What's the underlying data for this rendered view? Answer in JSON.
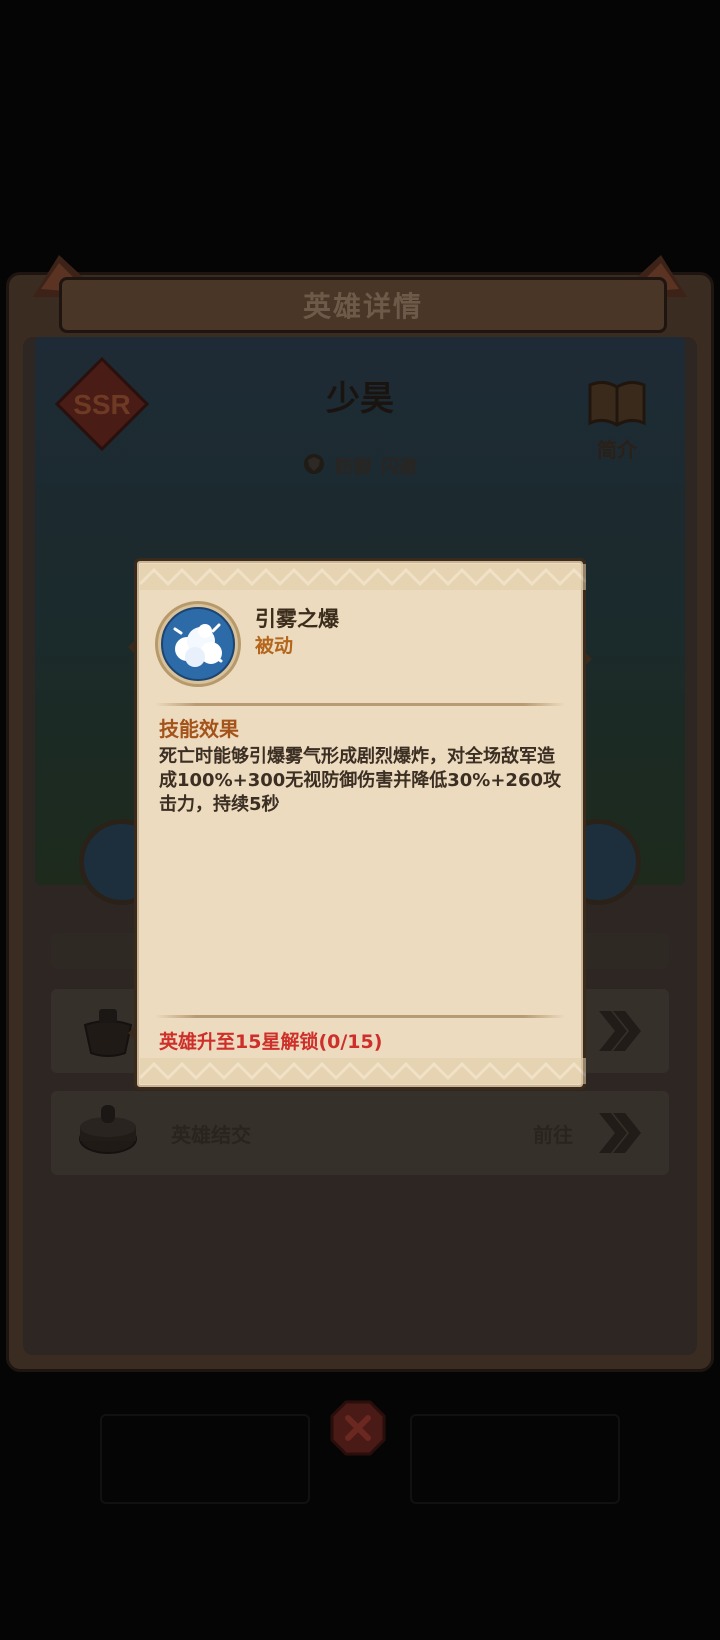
{
  "panel": {
    "title": "英雄详情"
  },
  "hero": {
    "name": "少昊",
    "rarity": "SSR",
    "tags": [
      "防御",
      "闪避"
    ],
    "intro_label": "简介"
  },
  "rows": [
    {
      "label": "",
      "goto": ""
    },
    {
      "label": "英雄结交",
      "goto": "前往"
    }
  ],
  "skill_popup": {
    "skill_name": "引雾之爆",
    "skill_type": "被动",
    "effect_title": "技能效果",
    "effect_text": "死亡时能够引爆雾气形成剧烈爆炸，对全场敌军造成100%+300无视防御伤害并降低30%+260攻击力，持续5秒",
    "unlock_text": "英雄升至15星解锁(0/15)"
  },
  "icons": {
    "skill": "cloud-explosion-icon",
    "close": "close-icon",
    "arrow": "double-chevron-right-icon",
    "book": "book-icon",
    "shield": "shield-icon"
  },
  "colors": {
    "popup_bg": "#eddbbf",
    "skill_type": "#b3661c",
    "effect_title": "#a4531a",
    "unlock": "#cf2f2a"
  }
}
